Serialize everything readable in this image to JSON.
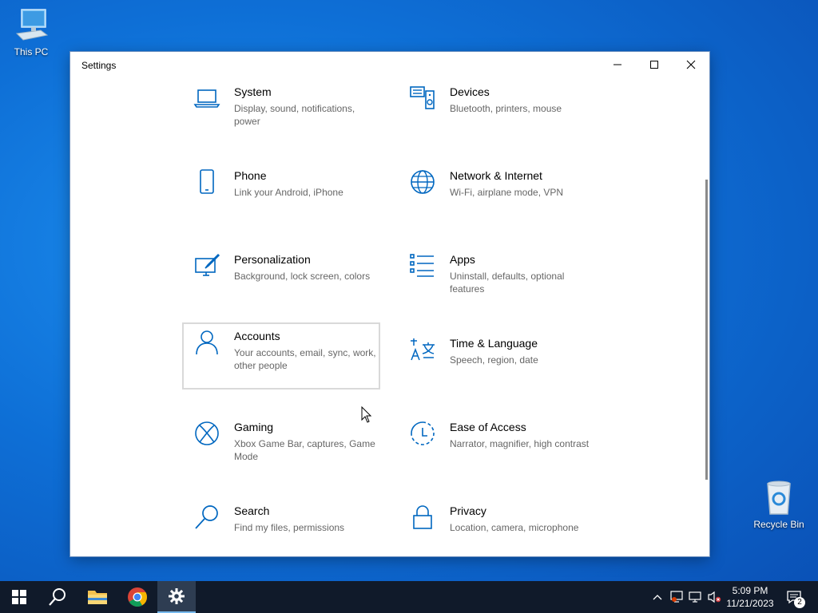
{
  "desktop": {
    "this_pc": "This PC",
    "recycle_bin": "Recycle Bin"
  },
  "window": {
    "title": "Settings",
    "accent": "#0067c0"
  },
  "tiles": [
    {
      "title": "System",
      "desc": "Display, sound, notifications, power",
      "icon": "laptop-icon"
    },
    {
      "title": "Devices",
      "desc": "Bluetooth, printers, mouse",
      "icon": "devices-icon"
    },
    {
      "title": "Phone",
      "desc": "Link your Android, iPhone",
      "icon": "phone-icon"
    },
    {
      "title": "Network & Internet",
      "desc": "Wi-Fi, airplane mode, VPN",
      "icon": "globe-icon"
    },
    {
      "title": "Personalization",
      "desc": "Background, lock screen, colors",
      "icon": "paintbrush-icon"
    },
    {
      "title": "Apps",
      "desc": "Uninstall, defaults, optional features",
      "icon": "apps-list-icon"
    },
    {
      "title": "Accounts",
      "desc": "Your accounts, email, sync, work, other people",
      "icon": "person-icon"
    },
    {
      "title": "Time & Language",
      "desc": "Speech, region, date",
      "icon": "time-language-icon"
    },
    {
      "title": "Gaming",
      "desc": "Xbox Game Bar, captures, Game Mode",
      "icon": "xbox-icon"
    },
    {
      "title": "Ease of Access",
      "desc": "Narrator, magnifier, high contrast",
      "icon": "ease-of-access-icon"
    },
    {
      "title": "Search",
      "desc": "Find my files, permissions",
      "icon": "search-icon"
    },
    {
      "title": "Privacy",
      "desc": "Location, camera, microphone",
      "icon": "lock-icon"
    }
  ],
  "taskbar": {
    "time": "5:09 PM",
    "date": "11/21/2023",
    "notification_count": "2"
  }
}
